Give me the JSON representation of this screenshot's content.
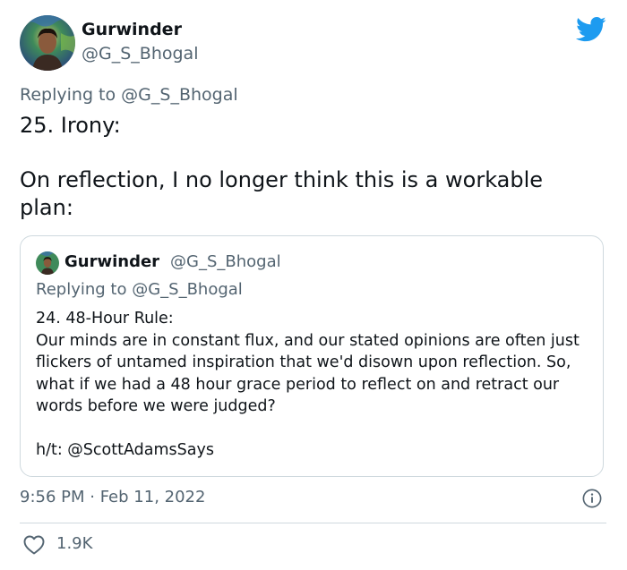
{
  "author": {
    "display_name": "Gurwinder",
    "handle": "@G_S_Bhogal",
    "avatar": "avatar-photo"
  },
  "brand": {
    "icon": "twitter-bird-icon",
    "color": "#1d9bf0"
  },
  "tweet": {
    "replying_prefix": "Replying to ",
    "replying_handle": "@G_S_Bhogal",
    "line1": "25. Irony:",
    "line2": "On reflection, I no longer think this is a workable plan:",
    "timestamp": "9:56 PM · Feb 11, 2022",
    "likes": "1.9K"
  },
  "quoted_tweet": {
    "display_name": "Gurwinder",
    "handle": "@G_S_Bhogal",
    "replying_prefix": "Replying to ",
    "replying_handle": "@G_S_Bhogal",
    "title": "24. 48-Hour Rule:",
    "body": "Our minds are in constant flux, and our stated opinions are often just flickers of untamed inspiration that we'd disown upon reflection. So, what if we had a 48 hour grace period to reflect on and retract our words before we were judged?",
    "hat_tip": "h/t: @ScottAdamsSays"
  },
  "colors": {
    "text": "#0f1419",
    "secondary": "#536471",
    "border": "#cfd9de"
  }
}
